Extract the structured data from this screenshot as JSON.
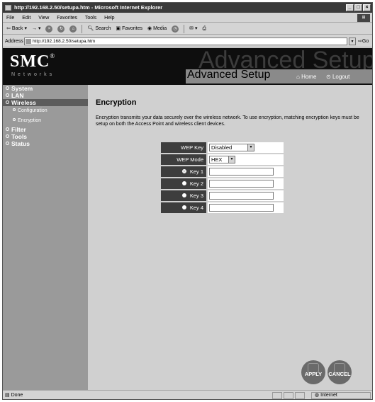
{
  "window": {
    "title": "http://192.168.2.50/setupa.htm - Microsoft Internet Explorer"
  },
  "menu": {
    "items": [
      "File",
      "Edit",
      "View",
      "Favorites",
      "Tools",
      "Help"
    ]
  },
  "toolbar": {
    "back": "Back",
    "search": "Search",
    "favorites": "Favorites",
    "media": "Media"
  },
  "address": {
    "label": "Address",
    "url": "http://192.168.2.50/setupa.htm",
    "go": "Go"
  },
  "header": {
    "logo": "SMC",
    "logo_mark": "®",
    "logo_sub": "Networks",
    "ghost_title": "Advanced Setup",
    "title": "Advanced Setup",
    "home": "Home",
    "logout": "Logout"
  },
  "sidebar": {
    "items": [
      {
        "label": "System"
      },
      {
        "label": "LAN"
      },
      {
        "label": "Wireless"
      }
    ],
    "sub_items": [
      {
        "label": "Configuration"
      },
      {
        "label": "Encryption"
      }
    ],
    "items_after": [
      {
        "label": "Filter"
      },
      {
        "label": "Tools"
      },
      {
        "label": "Status"
      }
    ]
  },
  "page": {
    "title": "Encryption",
    "description": "Encryption transmits your data securely over the wireless network. To use encryption, matching encryption keys must be setup on both the Access Point and wireless client devices."
  },
  "form": {
    "wep_key_label": "WEP Key",
    "wep_key_value": "Disabled",
    "wep_mode_label": "WEP Mode",
    "wep_mode_value": "HEX",
    "keys": [
      {
        "label": "Key 1",
        "selected": true
      },
      {
        "label": "Key 2",
        "selected": false
      },
      {
        "label": "Key 3",
        "selected": false
      },
      {
        "label": "Key 4",
        "selected": false
      }
    ]
  },
  "actions": {
    "apply": "APPLY",
    "cancel": "CANCEL"
  },
  "status": {
    "text": "Done",
    "zone": "Internet"
  }
}
